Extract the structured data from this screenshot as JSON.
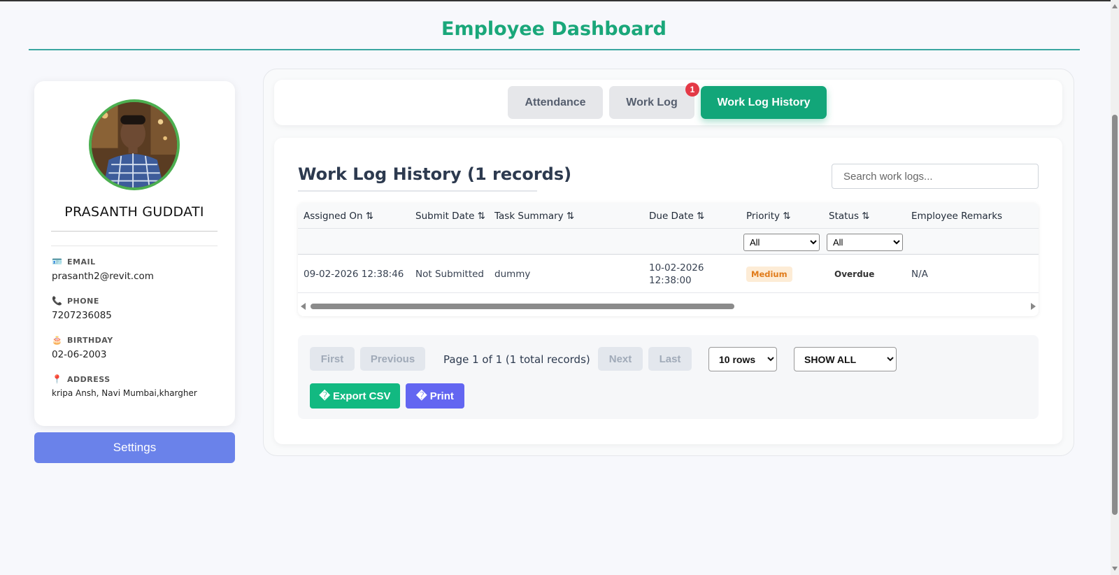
{
  "header": {
    "title": "Employee Dashboard"
  },
  "profile": {
    "name": "PRASANTH GUDDATI",
    "fields": [
      {
        "icon": "id-card-icon",
        "glyph": "🪪",
        "label": "EMAIL",
        "value": "prasanth2@revit.com"
      },
      {
        "icon": "phone-icon",
        "glyph": "📞",
        "label": "PHONE",
        "value": "7207236085"
      },
      {
        "icon": "cake-icon",
        "glyph": "🎂",
        "label": "BIRTHDAY",
        "value": "02-06-2003"
      },
      {
        "icon": "pin-icon",
        "glyph": "📍",
        "label": "ADDRESS",
        "value": "kripa Ansh, Navi Mumbai,khargher"
      }
    ],
    "settings_label": "Settings"
  },
  "tabs": [
    {
      "label": "Attendance",
      "active": false
    },
    {
      "label": "Work Log",
      "active": false,
      "badge": "1"
    },
    {
      "label": "Work Log History",
      "active": true
    }
  ],
  "history": {
    "title": "Work Log History (1 records)",
    "search_placeholder": "Search work logs...",
    "columns": [
      "Assigned On ⇅",
      "Submit Date ⇅",
      "Task Summary ⇅",
      "Due Date ⇅",
      "Priority ⇅",
      "Status ⇅",
      "Employee Remarks"
    ],
    "filters": {
      "priority": "All",
      "status": "All"
    },
    "rows": [
      {
        "assigned_on": "09-02-2026 12:38:46",
        "submit_date": "Not Submitted",
        "task_summary": "dummy",
        "due_date_line1": "10-02-2026",
        "due_date_line2": "12:38:00",
        "priority": "Medium",
        "status": "Overdue",
        "remarks": "N/A"
      }
    ]
  },
  "pagination": {
    "first": "First",
    "previous": "Previous",
    "page_info": "Page 1 of 1 (1 total records)",
    "next": "Next",
    "last": "Last",
    "rows_select": "10 rows",
    "show_select": "SHOW ALL",
    "export_label": "� Export CSV",
    "print_label": "� Print"
  },
  "colors": {
    "accent_green": "#12a679",
    "settings_blue": "#6a82ea",
    "print_purple": "#6366f1",
    "badge_red": "#e53946"
  }
}
